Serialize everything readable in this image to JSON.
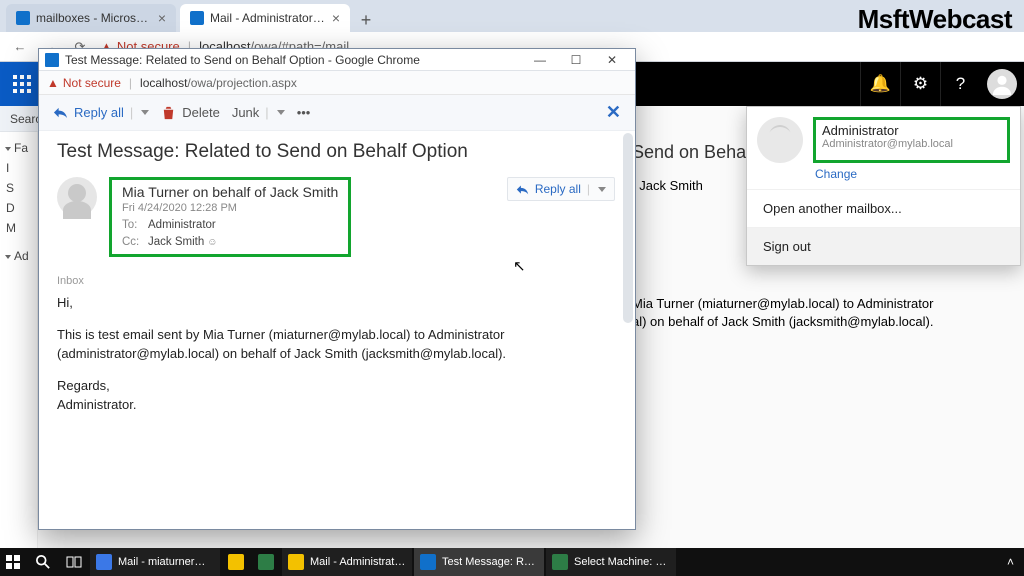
{
  "browser": {
    "tabs": [
      {
        "title": "mailboxes - Microsoft Exchange",
        "favColor": "#1070ca"
      },
      {
        "title": "Mail - Administrator@mylab.loca",
        "favColor": "#1070ca"
      }
    ],
    "newTab": "+",
    "back": "←",
    "forward": "→",
    "reload": "⟳",
    "notSecure": "Not secure",
    "addressHost": "localhost",
    "addressPath": "/owa/#path=/mail"
  },
  "owa": {
    "searchLabel": "Searc",
    "folders": {
      "fav": "Fa",
      "in": "I",
      "se": "S",
      "dr": "D",
      "m": "M",
      "ad": "Ad"
    },
    "headerIcons": {
      "bell": "🔔",
      "gear": "⚙",
      "help": "?"
    }
  },
  "bgRead": {
    "subject": "Send on Behal",
    "from": "f Jack Smith",
    "bodyLine1": "Mia Turner (miaturner@mylab.local) to Administrator",
    "bodyLine2": "al) on behalf of Jack Smith (jacksmith@mylab.local)."
  },
  "profile": {
    "name": "Administrator",
    "email": "Administrator@mylab.local",
    "change": "Change",
    "openAnother": "Open another mailbox...",
    "signOut": "Sign out"
  },
  "popup": {
    "windowTitle": "Test Message: Related to Send on Behalf Option - Google Chrome",
    "notSecure": "Not secure",
    "addressHost": "localhost",
    "addressPath": "/owa/projection.aspx",
    "toolbar": {
      "replyAll": "Reply all",
      "delete": "Delete",
      "junk": "Junk",
      "more": "•••",
      "close": "✕"
    },
    "subject": "Test Message: Related to Send on Behalf Option",
    "senderLine": "Mia Turner on behalf of Jack Smith",
    "sentDate": "Fri 4/24/2020 12:28 PM",
    "toLabel": "To:",
    "toValue": "Administrator",
    "ccLabel": "Cc:",
    "ccValue": "Jack Smith",
    "miniReply": "Reply all",
    "inboxLabel": "Inbox",
    "body": {
      "greeting": "Hi,",
      "para": "This is test email sent by Mia Turner (miaturner@mylab.local) to Administrator (administrator@mylab.local) on behalf of Jack Smith (jacksmith@mylab.local).",
      "regards1": "Regards,",
      "regards2": "Administrator."
    }
  },
  "taskbar": {
    "apps": [
      {
        "label": "",
        "color": "#ffffff"
      },
      {
        "label": "",
        "color": "#ffffff"
      },
      {
        "label": "",
        "color": "#ffffff"
      },
      {
        "label": "Mail - miaturner@...",
        "color": "#3b78e7"
      },
      {
        "label": "",
        "color": "#f3c100"
      },
      {
        "label": "",
        "color": "#2d7d46"
      },
      {
        "label": "Mail - Administrato...",
        "color": "#f3c100"
      },
      {
        "label": "Test Message: Relat...",
        "color": "#1070ca"
      },
      {
        "label": "Select Machine: WS...",
        "color": "#2d7d46"
      }
    ]
  },
  "brand": "MsftWebcast"
}
